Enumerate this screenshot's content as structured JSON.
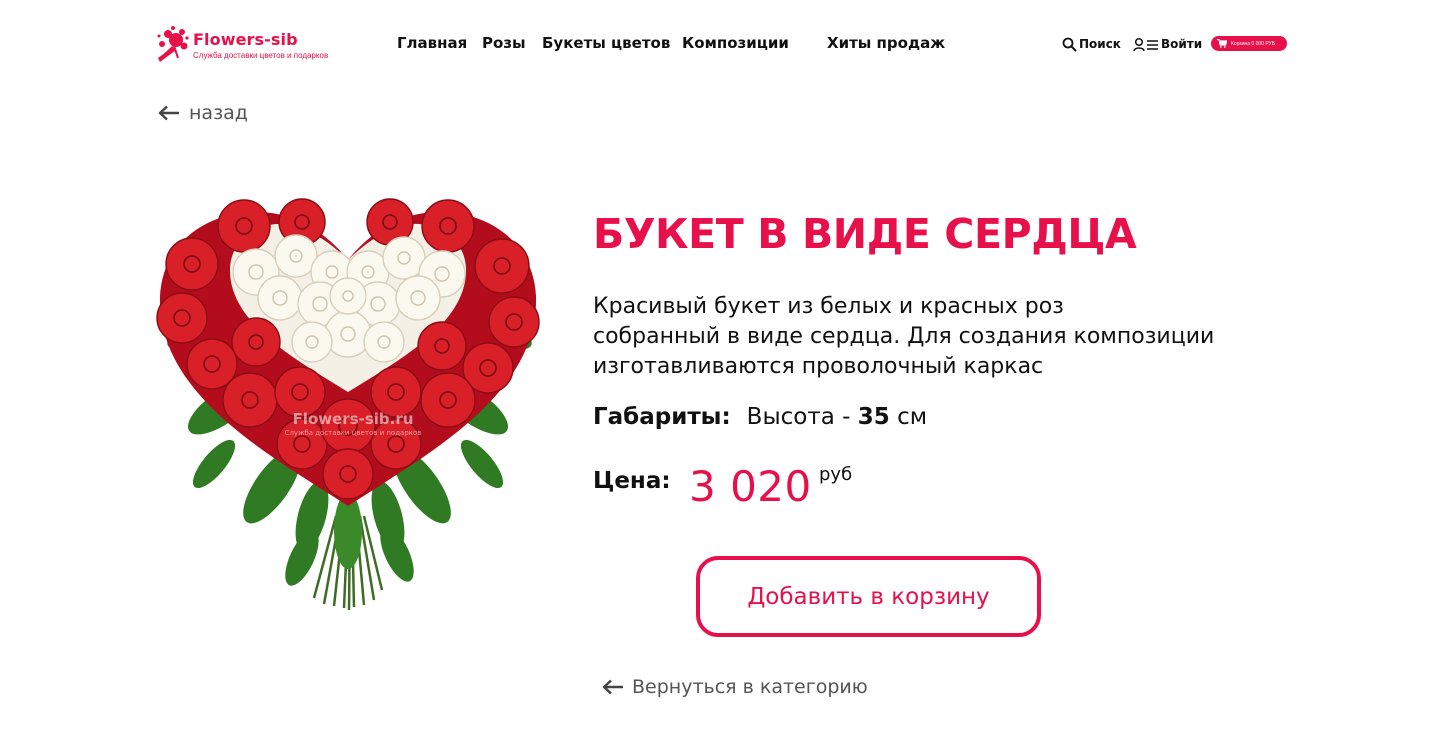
{
  "brand": {
    "name": "Flowers-sib",
    "tagline": "Служба доставки цветов и подарков",
    "accent_color": "#e8104a"
  },
  "nav": {
    "items": [
      {
        "label": "Главная"
      },
      {
        "label": "Розы"
      },
      {
        "label": "Букеты цветов"
      },
      {
        "label": "Композиции"
      },
      {
        "label": "Хиты продаж"
      }
    ]
  },
  "tools": {
    "search_label": "Поиск",
    "search_icon": "search-icon",
    "login_label": "Войти",
    "login_icon": "user-menu-icon",
    "cart_label": "Корзина 0 000 РУБ",
    "cart_icon": "shopping-cart-icon"
  },
  "back": {
    "label": "назад",
    "icon": "arrow-left-icon"
  },
  "product": {
    "title": "БУКЕТ В ВИДЕ СЕРДЦА",
    "description": [
      "Красивый букет из белых и красных роз",
      "собранный в виде сердца. Для создания композиции",
      "изготавливаются проволочный каркас"
    ],
    "dimensions_label": "Габариты:",
    "dimensions_prefix": "Высота - ",
    "dimensions_value": "35",
    "dimensions_unit": " см",
    "price_label": "Цена:",
    "price_value": "3 020",
    "price_currency": "руб",
    "image": {
      "subject": "heart-shaped bouquet of red and white roses",
      "watermark": "Flowers-sib.ru",
      "watermark_sub": "Служба доставки цветов и подарков"
    }
  },
  "actions": {
    "add_to_cart": "Добавить в корзину",
    "return_to_category": "Вернуться в категорию"
  }
}
